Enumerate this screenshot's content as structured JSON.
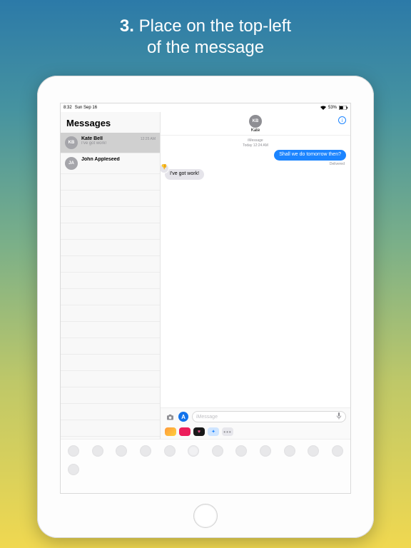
{
  "caption": {
    "step": "3.",
    "text1": "Place on the top-left",
    "text2": "of the message"
  },
  "status": {
    "time": "8:32",
    "date": "Sun Sep 16",
    "battery_pct": "53%",
    "wifi": "wifi"
  },
  "sidebar": {
    "title": "Messages",
    "items": [
      {
        "initials": "KB",
        "name": "Kate Bell",
        "time": "12:25 AM",
        "preview": "I've got work!",
        "selected": true
      },
      {
        "initials": "JA",
        "name": "John Appleseed",
        "time": "",
        "preview": "",
        "selected": false
      }
    ]
  },
  "chat": {
    "initials": "KB",
    "name": "Kate",
    "service": "iMessage",
    "timestamp": "Today 12:24 AM",
    "outgoing": "Shall we do tomorrow then?",
    "delivered": "Delivered",
    "incoming": "I've got work!",
    "reaction_glyph": "👎"
  },
  "input": {
    "placeholder": "iMessage"
  },
  "colors": {
    "accent": "#1b84ff"
  }
}
